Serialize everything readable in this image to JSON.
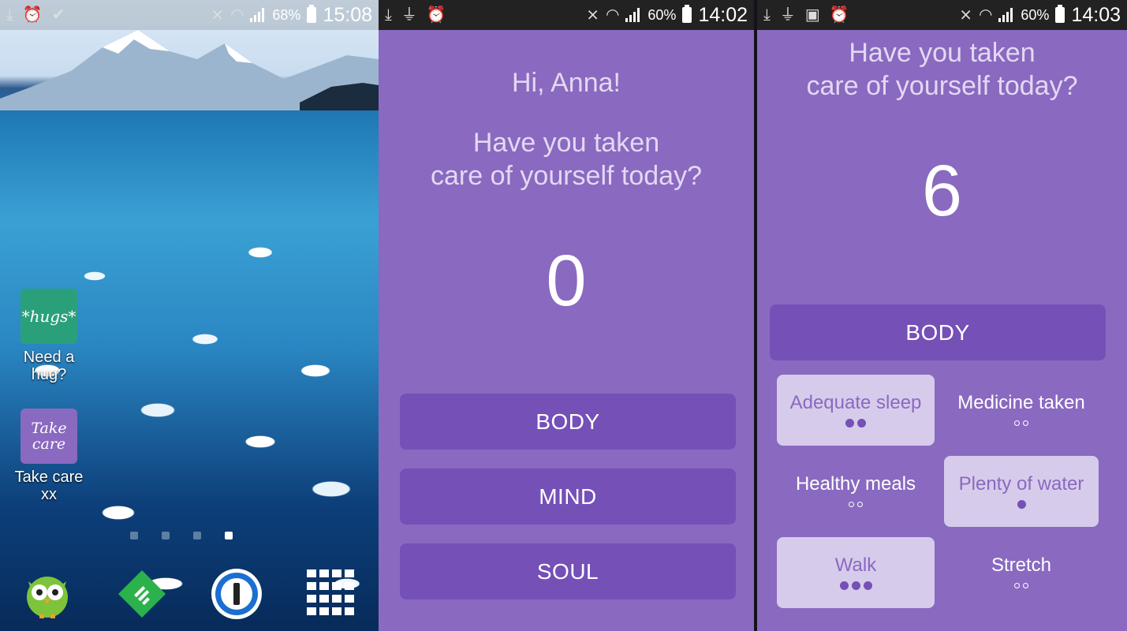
{
  "screen1": {
    "status": {
      "battery": "68%",
      "time": "15:08"
    },
    "apps": [
      {
        "tile_text": "*hugs*",
        "label": "Need a hug?",
        "color": "#2aa07a"
      },
      {
        "tile_text": "Take care",
        "label": "Take care xx",
        "color": "#8a69c0"
      }
    ],
    "dock_icons": [
      "owl-app-icon",
      "feedly-icon",
      "1password-icon",
      "app-drawer-icon"
    ]
  },
  "screen2": {
    "status": {
      "battery": "60%",
      "time": "14:02"
    },
    "greeting": "Hi, Anna!",
    "question_line1": "Have you taken",
    "question_line2": "care of yourself today?",
    "count": "0",
    "categories": [
      "BODY",
      "MIND",
      "SOUL"
    ]
  },
  "screen3": {
    "status": {
      "battery": "60%",
      "time": "14:03"
    },
    "question_line1": "Have you taken",
    "question_line2": "care of yourself today?",
    "count": "6",
    "category": "BODY",
    "items": [
      {
        "name": "Adequate sleep",
        "selected": true,
        "filled_dots": 2
      },
      {
        "name": "Medicine taken",
        "selected": false,
        "empty_dots": 2
      },
      {
        "name": "Healthy meals",
        "selected": false,
        "empty_dots": 2
      },
      {
        "name": "Plenty of water",
        "selected": true,
        "filled_dots": 1
      },
      {
        "name": "Walk",
        "selected": true,
        "filled_dots": 3
      },
      {
        "name": "Stretch",
        "selected": false,
        "empty_dots": 2
      }
    ]
  },
  "colors": {
    "app_background": "#8a69c0",
    "button": "#7550b7",
    "selected_item": "#d7cbeb"
  }
}
